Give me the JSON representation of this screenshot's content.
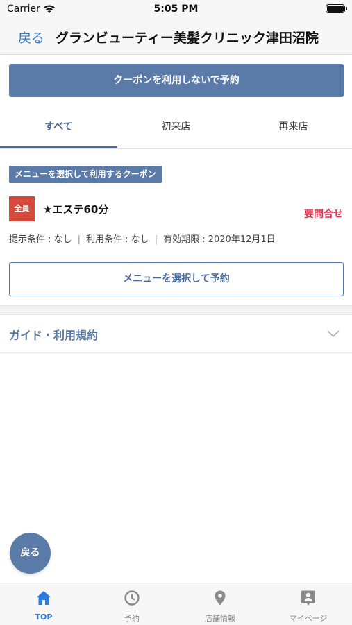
{
  "status_bar": {
    "carrier": "Carrier",
    "time": "5:05 PM"
  },
  "nav": {
    "back_label": "戻る",
    "title": "グランビューティー美髪クリニック津田沼院"
  },
  "primary_button": "クーポンを利用しないで予約",
  "tabs": [
    {
      "label": "すべて"
    },
    {
      "label": "初来店"
    },
    {
      "label": "再来店"
    }
  ],
  "coupon": {
    "section_tag": "メニューを選択して利用するクーポン",
    "badge": "全員",
    "title": "★エステ60分",
    "price_status": "要問合せ",
    "conditions": {
      "presentation": "提示条件 : なし",
      "usage": "利用条件 : なし",
      "expiry": "有効期限 : 2020年12月1日",
      "separator": "|"
    },
    "select_menu_button": "メニューを選択して予約"
  },
  "guide": {
    "label": "ガイド・利用規約"
  },
  "fab": {
    "label": "戻る"
  },
  "tab_bar": [
    {
      "label": "TOP",
      "icon": "home-icon"
    },
    {
      "label": "予約",
      "icon": "clock-icon"
    },
    {
      "label": "店舗情報",
      "icon": "location-pin-icon"
    },
    {
      "label": "マイページ",
      "icon": "profile-icon"
    }
  ],
  "colors": {
    "accent": "#5a7aa8",
    "badge": "#d64a3c",
    "inquiry": "#e0304a",
    "tab_active": "#2d7be0",
    "ios_link": "#3478c6"
  }
}
